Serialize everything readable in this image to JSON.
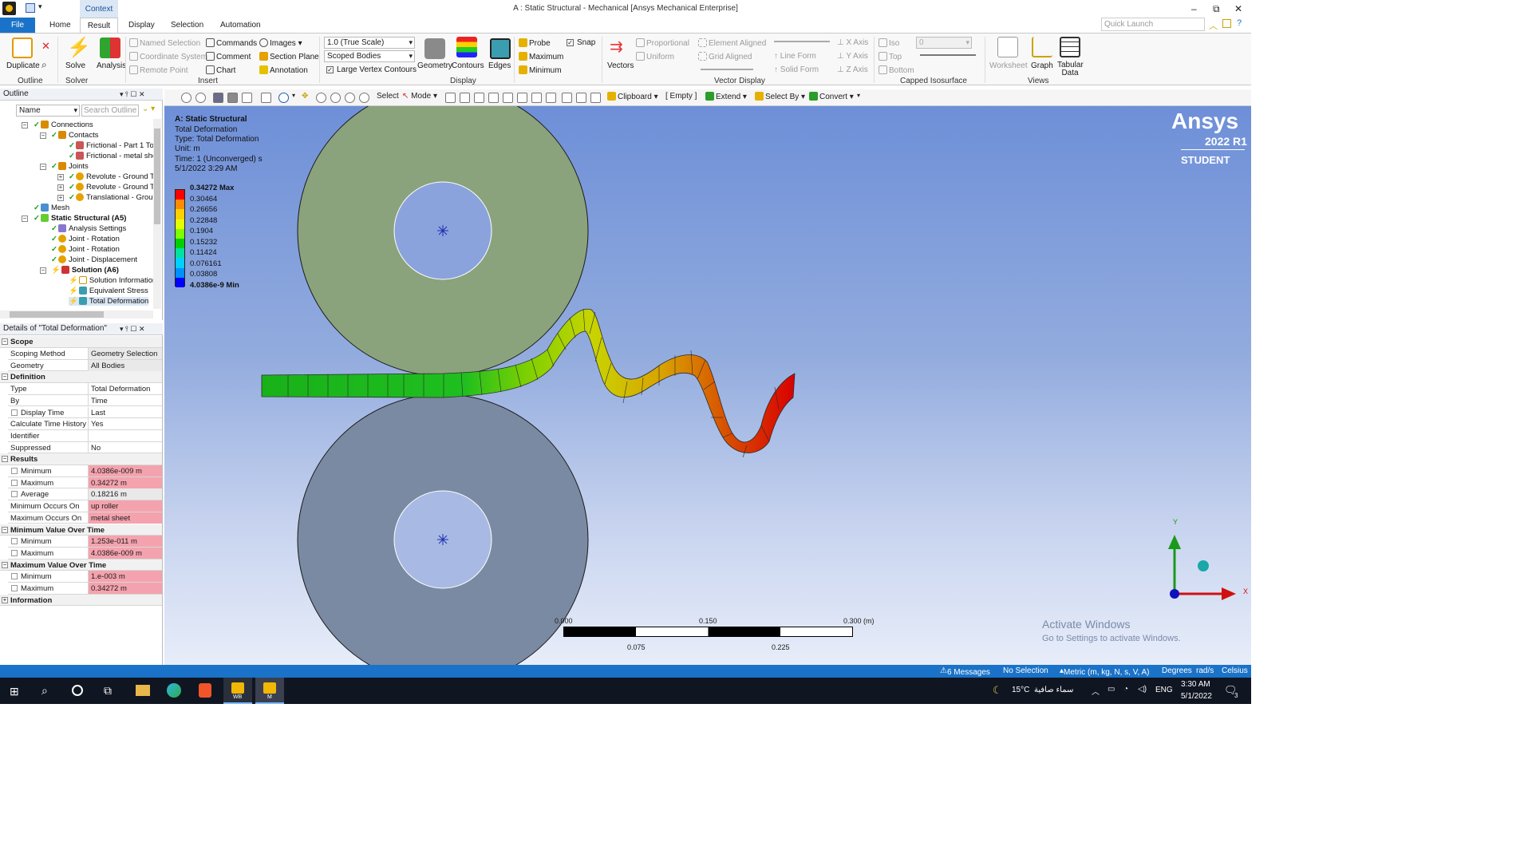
{
  "window": {
    "title": "A : Static Structural - Mechanical [Ansys Mechanical Enterprise]",
    "context_tab": "Context",
    "quick_launch_placeholder": "Quick Launch"
  },
  "tabs": [
    "File",
    "Home",
    "Result",
    "Display",
    "Selection",
    "Automation"
  ],
  "ribbon": {
    "outline": {
      "duplicate": "Duplicate",
      "group": "Outline"
    },
    "solve": {
      "solve": "Solve",
      "group": "Solver"
    },
    "analysis": "Analysis",
    "insert": {
      "named_selection": "Named Selection",
      "coordinate_system": "Coordinate System",
      "remote_point": "Remote Point",
      "commands": "Commands",
      "comment": "Comment",
      "chart": "Chart",
      "images": "Images",
      "section_plane": "Section Plane",
      "annotation": "Annotation",
      "group": "Insert"
    },
    "display": {
      "scale": "1.0 (True Scale)",
      "scope": "Scoped Bodies",
      "large_vertex": "Large Vertex Contours",
      "geometry": "Geometry",
      "contours": "Contours",
      "edges": "Edges",
      "group": "Display"
    },
    "probe": {
      "probe": "Probe",
      "maximum": "Maximum",
      "minimum": "Minimum",
      "snap": "Snap"
    },
    "vectors": "Vectors",
    "vector_display": {
      "proportional": "Proportional",
      "uniform": "Uniform",
      "element_aligned": "Element Aligned",
      "grid_aligned": "Grid Aligned",
      "line_form": "Line Form",
      "solid_form": "Solid Form",
      "x_axis": "X Axis",
      "y_axis": "Y Axis",
      "z_axis": "Z Axis",
      "group": "Vector Display"
    },
    "capped": {
      "iso": "Iso",
      "top": "Top",
      "bottom": "Bottom",
      "value": "0",
      "group": "Capped Isosurface"
    },
    "views": {
      "worksheet": "Worksheet",
      "graph": "Graph",
      "tabular": "Tabular Data",
      "group": "Views"
    }
  },
  "outline": {
    "title": "Outline",
    "filter": "Name",
    "search_placeholder": "Search Outline",
    "items": [
      "Connections",
      "Contacts",
      "Frictional - Part 1 To",
      "Frictional - metal she",
      "Joints",
      "Revolute - Ground T",
      "Revolute - Ground T",
      "Translational - Grou",
      "Mesh",
      "Static Structural (A5)",
      "Analysis Settings",
      "Joint - Rotation",
      "Joint - Rotation",
      "Joint - Displacement",
      "Solution (A6)",
      "Solution Information",
      "Equivalent Stress",
      "Total Deformation"
    ]
  },
  "details": {
    "title": "Details of \"Total Deformation\"",
    "sections": {
      "scope": "Scope",
      "definition": "Definition",
      "results": "Results",
      "min_over_time": "Minimum Value Over Time",
      "max_over_time": "Maximum Value Over Time",
      "information": "Information"
    },
    "rows": {
      "scoping_method": [
        "Scoping Method",
        "Geometry Selection"
      ],
      "geometry": [
        "Geometry",
        "All Bodies"
      ],
      "type": [
        "Type",
        "Total Deformation"
      ],
      "by": [
        "By",
        "Time"
      ],
      "display_time": [
        "Display Time",
        "Last"
      ],
      "calc_time_history": [
        "Calculate Time History",
        "Yes"
      ],
      "identifier": [
        "Identifier",
        ""
      ],
      "suppressed": [
        "Suppressed",
        "No"
      ],
      "res_min": [
        "Minimum",
        "4.0386e-009 m"
      ],
      "res_max": [
        "Maximum",
        "0.34272 m"
      ],
      "res_avg": [
        "Average",
        "0.18216 m"
      ],
      "min_occurs": [
        "Minimum Occurs On",
        "up roller"
      ],
      "max_occurs": [
        "Maximum Occurs On",
        "metal sheet"
      ],
      "mvot_min": [
        "Minimum",
        "1.253e-011 m"
      ],
      "mvot_max": [
        "Maximum",
        "4.0386e-009 m"
      ],
      "xvot_min": [
        "Minimum",
        "1.e-003 m"
      ],
      "xvot_max": [
        "Maximum",
        "0.34272 m"
      ]
    }
  },
  "graphics_toolbar": {
    "select": "Select",
    "mode": "Mode",
    "clipboard": "Clipboard",
    "empty": "[ Empty ]",
    "extend": "Extend",
    "select_by": "Select By",
    "convert": "Convert"
  },
  "viewport": {
    "info": {
      "title": "A: Static Structural",
      "line1": "Total Deformation",
      "line2": "Type: Total Deformation",
      "line3": "Unit: m",
      "line4": "Time: 1 (Unconverged) s",
      "line5": "5/1/2022 3:29 AM"
    },
    "legend": {
      "labels": [
        "0.34272 Max",
        "0.30464",
        "0.26656",
        "0.22848",
        "0.1904",
        "0.15232",
        "0.11424",
        "0.076161",
        "0.03808",
        "4.0386e-9 Min"
      ],
      "colors": [
        "#ff0000",
        "#ff8c00",
        "#ffd000",
        "#e6ff00",
        "#7cff00",
        "#00d000",
        "#00e0a0",
        "#00d0ff",
        "#0090ff",
        "#0000ff"
      ]
    },
    "brand": {
      "name": "Ansys",
      "version": "2022 R1",
      "edition": "STUDENT"
    },
    "scale_bar": {
      "t0": "0.000",
      "t1": "0.150",
      "t2": "0.300 (m)",
      "b1": "0.075",
      "b2": "0.225"
    },
    "axes": {
      "y": "Y",
      "x": "X"
    },
    "activate": {
      "line1": "Activate Windows",
      "line2": "Go to Settings to activate Windows."
    }
  },
  "status": {
    "messages": "6 Messages",
    "selection": "No Selection",
    "units": "Metric (m, kg, N, s, V, A)",
    "degrees": "Degrees",
    "rads": "rad/s",
    "celsius": "Celsius"
  },
  "taskbar": {
    "weather": "15°C",
    "weather_text": "سماء صافية",
    "lang": "ENG",
    "time": "3:30 AM",
    "date": "5/1/2022",
    "notif": "3",
    "wb_label": "WB",
    "m_label": "M"
  }
}
